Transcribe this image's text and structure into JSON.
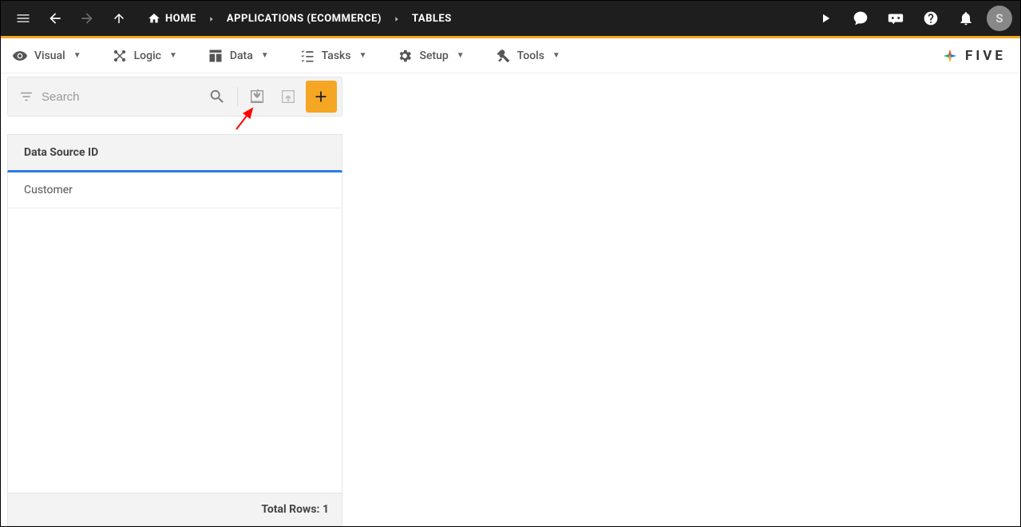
{
  "breadcrumb": {
    "home": "HOME",
    "applications": "APPLICATIONS (ECOMMERCE)",
    "tables": "TABLES"
  },
  "avatar_initial": "S",
  "menus": {
    "visual": "Visual",
    "logic": "Logic",
    "data": "Data",
    "tasks": "Tasks",
    "setup": "Setup",
    "tools": "Tools"
  },
  "logo_text": "FIVE",
  "panel": {
    "search_placeholder": "Search",
    "column_header": "Data Source ID",
    "rows": [
      {
        "label": "Customer"
      }
    ],
    "footer_label": "Total Rows:",
    "footer_count": "1"
  }
}
